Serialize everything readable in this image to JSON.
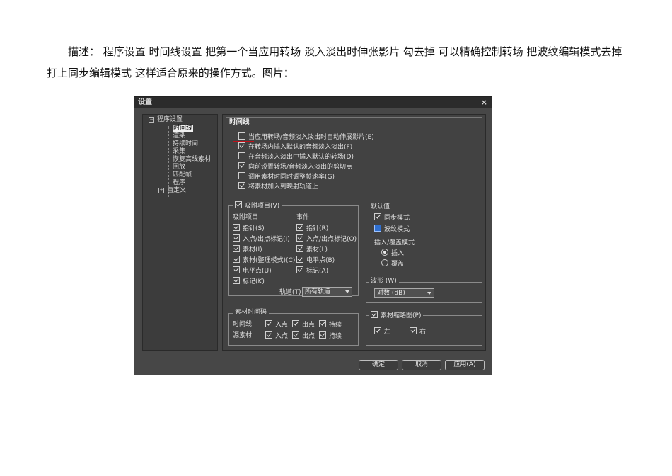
{
  "description": "描述： 程序设置 时间线设置 把第一个当应用转场 淡入淡出时伸张影片 勾去掉 可以精确控制转场 把波纹编辑模式去掉 打上同步编辑模式 这样适合原来的操作方式。图片：",
  "dialog": {
    "title": "设置",
    "close": "×",
    "tree": {
      "root": "程序设置",
      "root_toggle": "−",
      "children": [
        "时间线",
        "渲染",
        "持续时间",
        "采集",
        "恢复高线素材",
        "回放",
        "匹配帧",
        "程序"
      ],
      "custom": "自定义",
      "custom_toggle": "+"
    },
    "panel_title": "时间线",
    "options": [
      {
        "label": "当应用转场/音频淡入淡出时自动伸展影片(E)",
        "checked": false
      },
      {
        "label": "在转场内插入默认的音频淡入淡出(F)",
        "checked": true
      },
      {
        "label": "在音频淡入淡出中插入默认的转场(D)",
        "checked": false
      },
      {
        "label": "向前设置转场/音频淡入淡出的剪切点",
        "checked": true
      },
      {
        "label": "调用素材时同时调整帧速率(G)",
        "checked": false
      },
      {
        "label": "将素材加入到映射轨道上",
        "checked": true
      }
    ],
    "snap": {
      "group_label": "吸附项目(V)",
      "col1_header": "吸附项目",
      "col2_header": "事件",
      "col1": [
        "指针(S)",
        "入点/出点标记(I)",
        "素材(I)",
        "素材(整理模式)(C)",
        "电平点(U)",
        "标记(K)"
      ],
      "col2": [
        "指针(R)",
        "入点/出点标记(O)",
        "素材(L)",
        "电平点(B)",
        "标记(A)"
      ],
      "track_label": "轨道(T)",
      "track_value": "所有轨道"
    },
    "defaults": {
      "group_label": "默认值",
      "sync_mode": "同步模式",
      "ripple_mode": "波纹模式",
      "insert_group": "插入/覆盖模式",
      "insert": "插入",
      "overwrite": "覆盖"
    },
    "waveform": {
      "group_label": "波形 (W)",
      "value": "对数 (dB)"
    },
    "timecode": {
      "group_label": "素材时间码",
      "timeline_label": "时间线:",
      "source_label": "源素材:",
      "items": [
        "入点",
        "出点",
        "持续"
      ]
    },
    "thumbnail": {
      "group_label": "素材缩略图(P)",
      "left": "左",
      "right": "右"
    },
    "buttons": {
      "ok": "确定",
      "cancel": "取消",
      "apply": "应用(A)"
    }
  },
  "colors": {
    "dialog_bg": "#474747",
    "panel_bg": "#424242",
    "annotation_red": "#c0101a",
    "ripple_blue": "#2f6fcf"
  }
}
